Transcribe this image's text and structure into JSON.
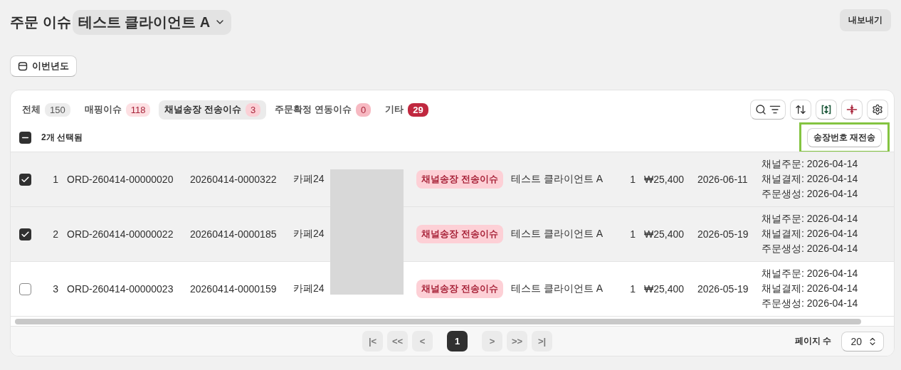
{
  "header": {
    "title": "주문 이슈",
    "client_select": {
      "value": "테스트 클라이언트 A"
    },
    "export_button": "내보내기"
  },
  "period_button": "이번년도",
  "tabs": [
    {
      "label": "전체",
      "count": "150",
      "color": "#ececec",
      "selected": false
    },
    {
      "label": "매핑이슈",
      "count": "118",
      "color": "#fde0e3",
      "selected": false
    },
    {
      "label": "채널송장 전송이슈",
      "count": "3",
      "color": "#fbd0d6",
      "selected": true
    },
    {
      "label": "주문확정 연동이슈",
      "count": "0",
      "color": "#f7b9c2",
      "selected": false
    },
    {
      "label": "기타",
      "count": "29",
      "color": "#c0283f",
      "selected": false
    }
  ],
  "selection": {
    "select_all": {
      "indeterminate": true
    },
    "label": "2개 선택됨",
    "action_button": "송장번호 재전송",
    "highlighted": true
  },
  "rows": [
    {
      "checked": true,
      "index": "1",
      "order_no": "ORD-260414-00000020",
      "invoice_no": "20260414-0000322",
      "channel": "카페24",
      "status": "채널송장 전송이슈",
      "client": "테스트 클라이언트 A",
      "qty": "1",
      "amount": "₩25,400",
      "date": "2026-06-11",
      "dates": [
        "채널주문: 2026-04-14",
        "채널결제: 2026-04-14",
        "주문생성: 2026-04-14"
      ]
    },
    {
      "checked": true,
      "index": "2",
      "order_no": "ORD-260414-00000022",
      "invoice_no": "20260414-0000185",
      "channel": "카페24",
      "status": "채널송장 전송이슈",
      "client": "테스트 클라이언트 A",
      "qty": "1",
      "amount": "₩25,400",
      "date": "2026-05-19",
      "dates": [
        "채널주문: 2026-04-14",
        "채널결제: 2026-04-14",
        "주문생성: 2026-04-14"
      ]
    },
    {
      "checked": false,
      "index": "3",
      "order_no": "ORD-260414-00000023",
      "invoice_no": "20260414-0000159",
      "channel": "카페24",
      "status": "채널송장 전송이슈",
      "client": "테스트 클라이언트 A",
      "qty": "1",
      "amount": "₩25,400",
      "date": "2026-05-19",
      "dates": [
        "채널주문: 2026-04-14",
        "채널결제: 2026-04-14",
        "주문생성: 2026-04-14"
      ]
    }
  ],
  "pagination": {
    "buttons": [
      {
        "label": "|<",
        "kind": "nav",
        "disabled": true,
        "selected": false
      },
      {
        "label": "<<",
        "kind": "nav",
        "disabled": true,
        "selected": false
      },
      {
        "label": "<",
        "kind": "nav",
        "disabled": true,
        "selected": false
      },
      {
        "label": "1",
        "kind": "page",
        "disabled": false,
        "selected": true
      },
      {
        "label": ">",
        "kind": "nav",
        "disabled": true,
        "selected": false
      },
      {
        "label": ">>",
        "kind": "nav",
        "disabled": true,
        "selected": false
      },
      {
        "label": ">|",
        "kind": "nav",
        "disabled": true,
        "selected": false
      }
    ],
    "page_size_label": "페이지 수",
    "page_size": "20"
  }
}
